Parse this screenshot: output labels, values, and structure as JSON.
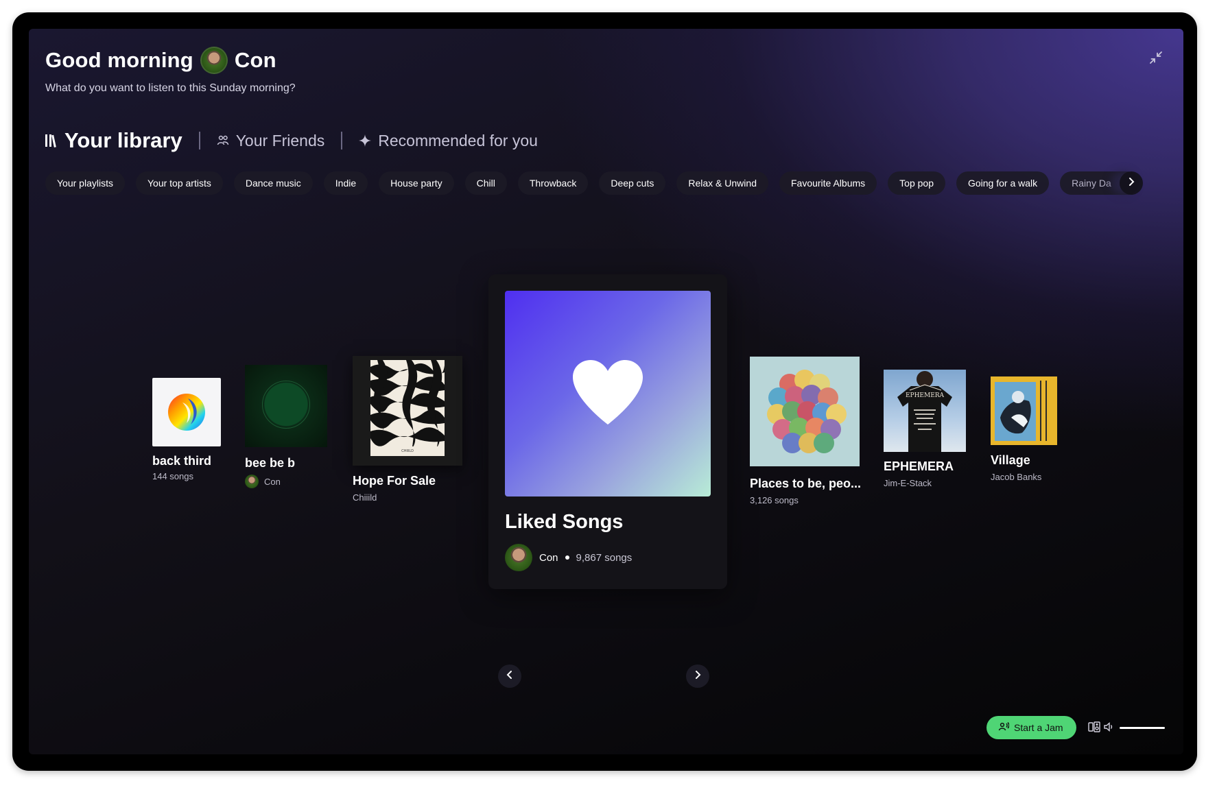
{
  "header": {
    "greeting_prefix": "Good morning",
    "user_name": "Con",
    "subtitle": "What do you want to listen to this Sunday morning?"
  },
  "tabs": [
    {
      "label": "Your library",
      "icon": "library-icon",
      "active": true
    },
    {
      "label": "Your Friends",
      "icon": "friends-icon",
      "active": false
    },
    {
      "label": "Recommended for you",
      "icon": "sparkle-icon",
      "active": false
    }
  ],
  "chips": [
    "Your playlists",
    "Your top artists",
    "Dance music",
    "Indie",
    "House party",
    "Chill",
    "Throwback",
    "Deep cuts",
    "Relax & Unwind",
    "Favourite Albums",
    "Top pop",
    "Going for a walk",
    "Rainy Da"
  ],
  "carousel": {
    "items": [
      {
        "title": "back third",
        "meta": "144 songs"
      },
      {
        "title": "bee be b",
        "meta": "Con",
        "owner_avatar": true
      },
      {
        "title": "Hope For Sale",
        "meta": "Chiiild",
        "cover_text": "CHIIILD"
      },
      {
        "title": "Places to be, peo...",
        "meta": "3,126 songs"
      },
      {
        "title": "EPHEMERA",
        "meta": "Jim-E-Stack",
        "cover_text": "EPHEMERA"
      },
      {
        "title": "Village",
        "meta": "Jacob Banks"
      }
    ],
    "featured": {
      "title": "Liked Songs",
      "owner": "Con",
      "count": "9,867 songs",
      "icon": "heart-icon"
    }
  },
  "footer": {
    "jam_label": "Start a Jam",
    "volume_level": 1.0
  },
  "colors": {
    "accent_green": "#4fd575",
    "liked_gradient_start": "#4f2ff0",
    "liked_gradient_end": "#b8ecd6"
  }
}
